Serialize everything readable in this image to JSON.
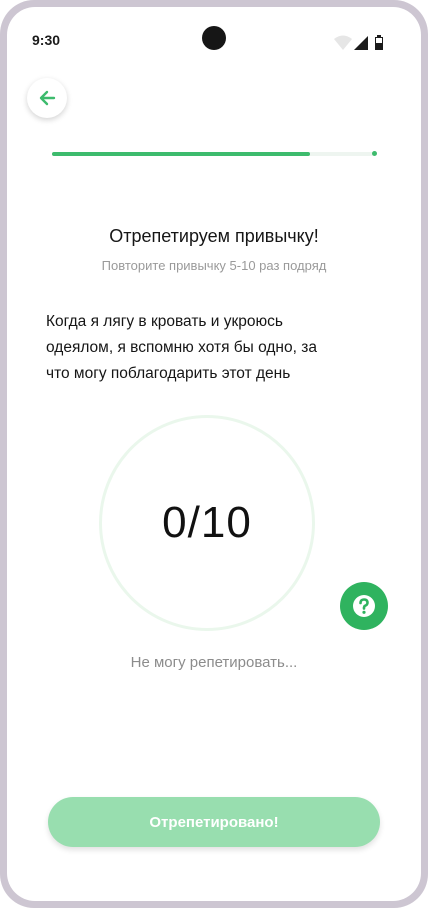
{
  "status_bar": {
    "time": "9:30"
  },
  "progress": {
    "value": 0.8
  },
  "header": {
    "title": "Отрепетируем привычку!",
    "subtitle": "Повторите привычку 5-10 раз подряд"
  },
  "habit": {
    "line1": "Когда я лягу в кровать и укроюсь",
    "line2": "одеялом, я вспомню хотя бы одно, за",
    "line3": "что могу поблагодарить этот день"
  },
  "counter": {
    "text": "0/10"
  },
  "links": {
    "cant_rehearse": "Не могу репетировать..."
  },
  "actions": {
    "primary": "Отрепетировано!"
  },
  "colors": {
    "accent": "#3dbb6d",
    "help_button": "#2fb35f",
    "primary_button_disabled": "#98deaf"
  },
  "icons": {
    "back": "arrow-left-icon",
    "help": "question-icon",
    "wifi": "wifi-icon",
    "signal": "signal-icon",
    "battery": "battery-icon"
  }
}
